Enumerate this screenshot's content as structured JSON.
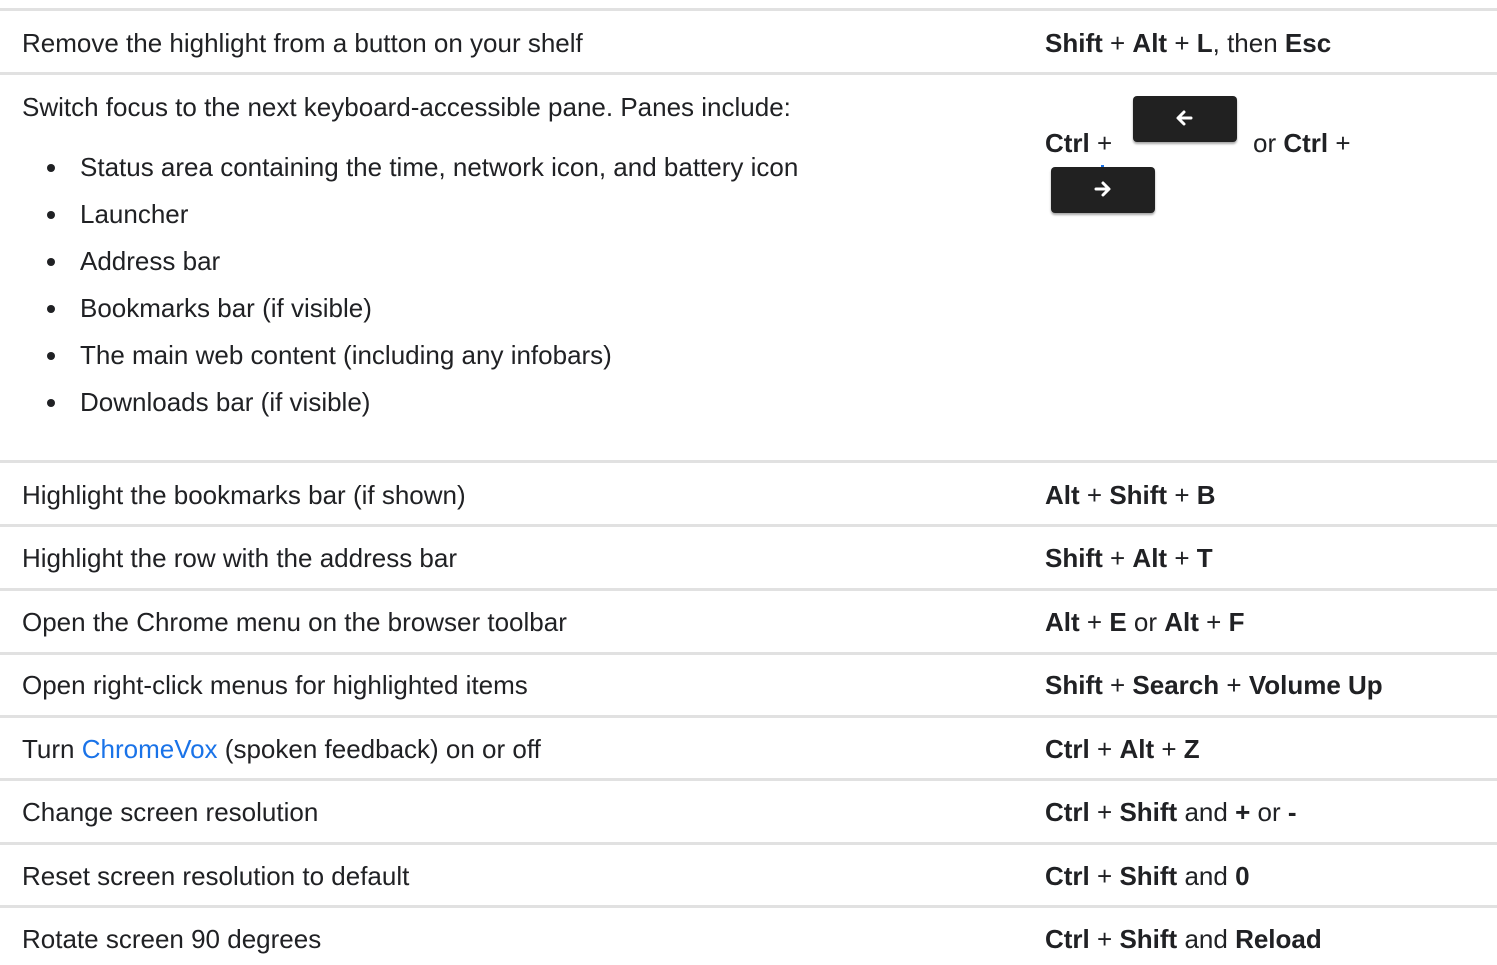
{
  "rows": [
    {
      "description": "Remove the highlight from a button on your shelf",
      "keys": [
        "Shift",
        "+",
        "Alt",
        "+",
        "L",
        ", then ",
        "Esc"
      ]
    },
    {
      "description": "Switch focus to the next keyboard-accessible pane. Panes include:",
      "panes": [
        "Status area containing the time, network icon, and battery icon",
        "Launcher",
        "Address bar",
        "Bookmarks bar (if visible)",
        "The main web content (including any infobars)",
        "Downloads bar (if visible)"
      ],
      "keys": [
        "Ctrl",
        "+",
        "or",
        "Ctrl",
        "+"
      ],
      "key_icons": [
        "back-arrow-key-icon",
        "forward-arrow-key-icon"
      ]
    },
    {
      "description": "Highlight the bookmarks bar (if shown)",
      "keys": [
        "Alt",
        "+",
        "Shift",
        "+",
        "B"
      ]
    },
    {
      "description": "Highlight the row with the address bar",
      "keys": [
        "Shift",
        "+",
        "Alt",
        "+",
        "T"
      ]
    },
    {
      "description": "Open the Chrome menu on the browser toolbar",
      "keys": [
        "Alt",
        "+",
        "E",
        "or",
        "Alt",
        "+",
        "F"
      ]
    },
    {
      "description": "Open right-click menus for highlighted items",
      "keys": [
        "Shift",
        "+",
        "Search",
        "+",
        "Volume Up"
      ]
    },
    {
      "description_prefix": "Turn ",
      "description_link": "ChromeVox",
      "description_suffix": " (spoken feedback) on or off",
      "keys": [
        "Ctrl",
        "+",
        "Alt",
        "+",
        "Z"
      ]
    },
    {
      "description": "Change screen resolution",
      "keys": [
        "Ctrl",
        "+",
        "Shift",
        "and",
        "+",
        "or",
        "-"
      ]
    },
    {
      "description": "Reset screen resolution to default",
      "keys": [
        "Ctrl",
        "+",
        "Shift",
        "and",
        "0"
      ]
    },
    {
      "description": "Rotate screen 90 degrees",
      "keys": [
        "Ctrl",
        "+",
        "Shift",
        "and",
        "Reload"
      ]
    }
  ],
  "colors": {
    "text": "#202124",
    "link": "#1a73e8",
    "divider": "#e1e1e1",
    "keycap": "#212121"
  }
}
